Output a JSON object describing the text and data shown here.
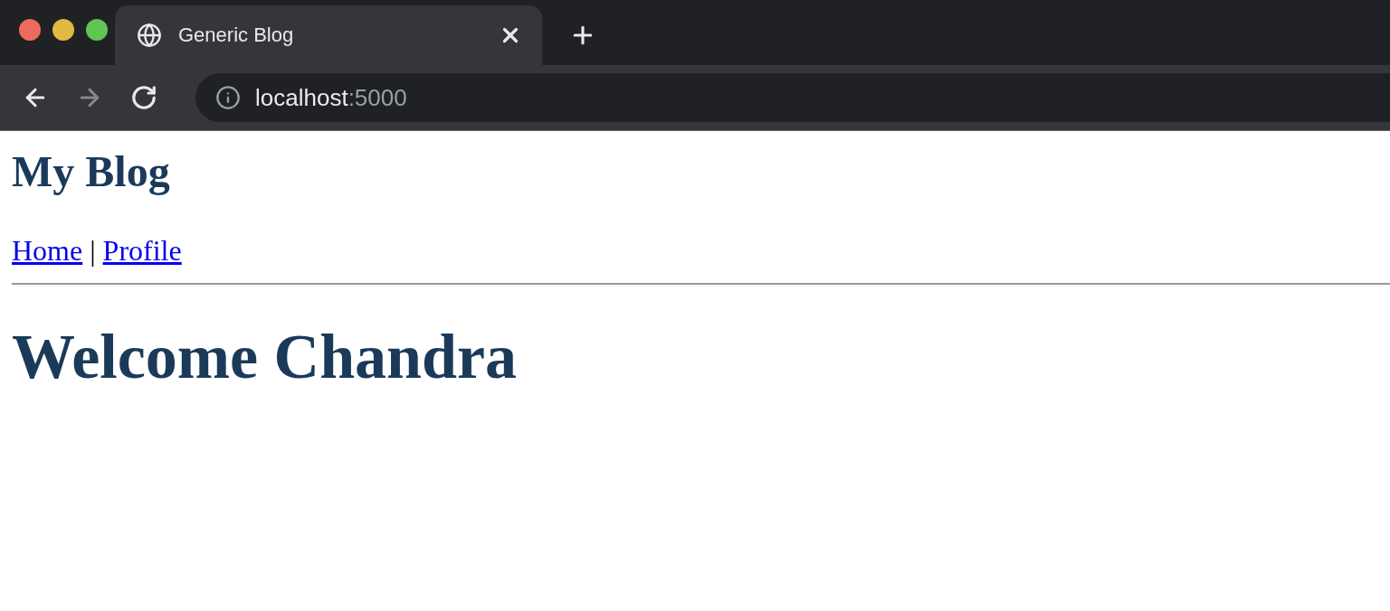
{
  "browser": {
    "tab": {
      "title": "Generic Blog"
    },
    "nav_buttons": [
      {
        "kind": "back",
        "disabled": false
      },
      {
        "kind": "forward",
        "disabled": true
      },
      {
        "kind": "reload",
        "disabled": false
      }
    ],
    "address": {
      "host": "localhost",
      "port": ":5000"
    }
  },
  "page": {
    "title": "My Blog",
    "nav": [
      {
        "label": "Home"
      },
      {
        "label": "Profile"
      }
    ],
    "separator": "|",
    "heading": "Welcome Chandra"
  }
}
